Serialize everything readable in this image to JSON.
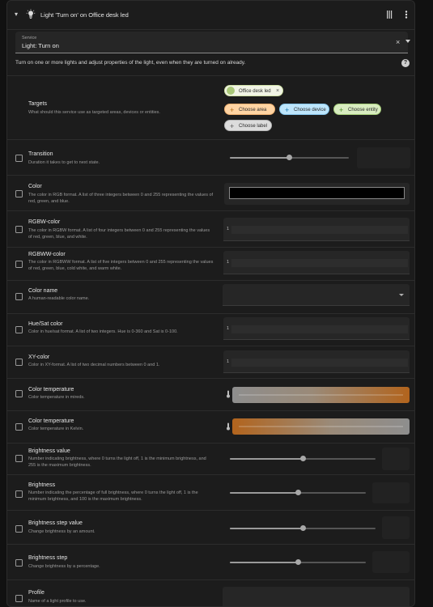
{
  "header": {
    "title": "Light 'Turn on' on Office desk led",
    "icons": [
      "chevron-down-icon",
      "lightbulb-icon",
      "drag-handle-icon",
      "more-vert-icon"
    ]
  },
  "service": {
    "label": "Service",
    "value": "Light: Turn on"
  },
  "description": "Turn on one or more lights and adjust properties of the light, even when they are turned on already.",
  "targets": {
    "title": "Targets",
    "description": "What should this service use as targeted areas, devices or entities.",
    "selected_entity": "Office desk led",
    "choose_area": "Choose area",
    "choose_device": "Choose device",
    "choose_entity": "Choose entity",
    "choose_label": "Choose label"
  },
  "rows": [
    {
      "title": "Transition",
      "desc": "Duration it takes to get to next state.",
      "checked": false,
      "slider_value": 0.5
    },
    {
      "title": "Color",
      "desc": "The color in RGB format. A list of three integers between 0 and 255 representing the values of red, green, and blue.",
      "checked": false,
      "color_value": "#000000"
    },
    {
      "title": "RGBW-color",
      "desc": "The color in RGBW format. A list of four integers between 0 and 255 representing the values of red, green, blue, and white.",
      "checked": false,
      "line_number": "1"
    },
    {
      "title": "RGBWW-color",
      "desc": "The color in RGBWW format. A list of five integers between 0 and 255 representing the values of red, green, blue, cold white, and warm white.",
      "checked": false,
      "line_number": "1"
    },
    {
      "title": "Color name",
      "desc": "A human-readable color name.",
      "checked": false
    },
    {
      "title": "Hue/Sat color",
      "desc": "Color in hue/sat format. A list of two integers. Hue is 0-360 and Sat is 0-100.",
      "checked": false,
      "line_number": "1"
    },
    {
      "title": "XY-color",
      "desc": "Color in XY-format. A list of two decimal numbers between 0 and 1.",
      "checked": false,
      "line_number": "1"
    },
    {
      "title": "Color temperature",
      "desc": "Color temperature in mireds.",
      "checked": false
    },
    {
      "title": "Color temperature",
      "desc": "Color temperature in Kelvin.",
      "checked": false
    },
    {
      "title": "Brightness value",
      "desc": "Number indicating brightness, where 0 turns the light off, 1 is the minimum brightness, and 255 is the maximum brightness.",
      "checked": false,
      "slider_value": 0.5
    },
    {
      "title": "Brightness",
      "desc": "Number indicating the percentage of full brightness, where 0 turns the light off, 1 is the minimum brightness, and 100 is the maximum brightness.",
      "checked": false,
      "slider_value": 0.5
    },
    {
      "title": "Brightness step value",
      "desc": "Change brightness by an amount.",
      "checked": false,
      "slider_value": 0.5
    },
    {
      "title": "Brightness step",
      "desc": "Change brightness by a percentage.",
      "checked": false,
      "slider_value": 0.5
    },
    {
      "title": "Profile",
      "desc": "Name of a light profile to use.",
      "checked": false
    }
  ],
  "colors": {
    "card_bg": "#1c1c1c",
    "page_bg": "#111111",
    "warm_orange": "#b2641d",
    "neutral_grey": "#8e8e8e"
  }
}
